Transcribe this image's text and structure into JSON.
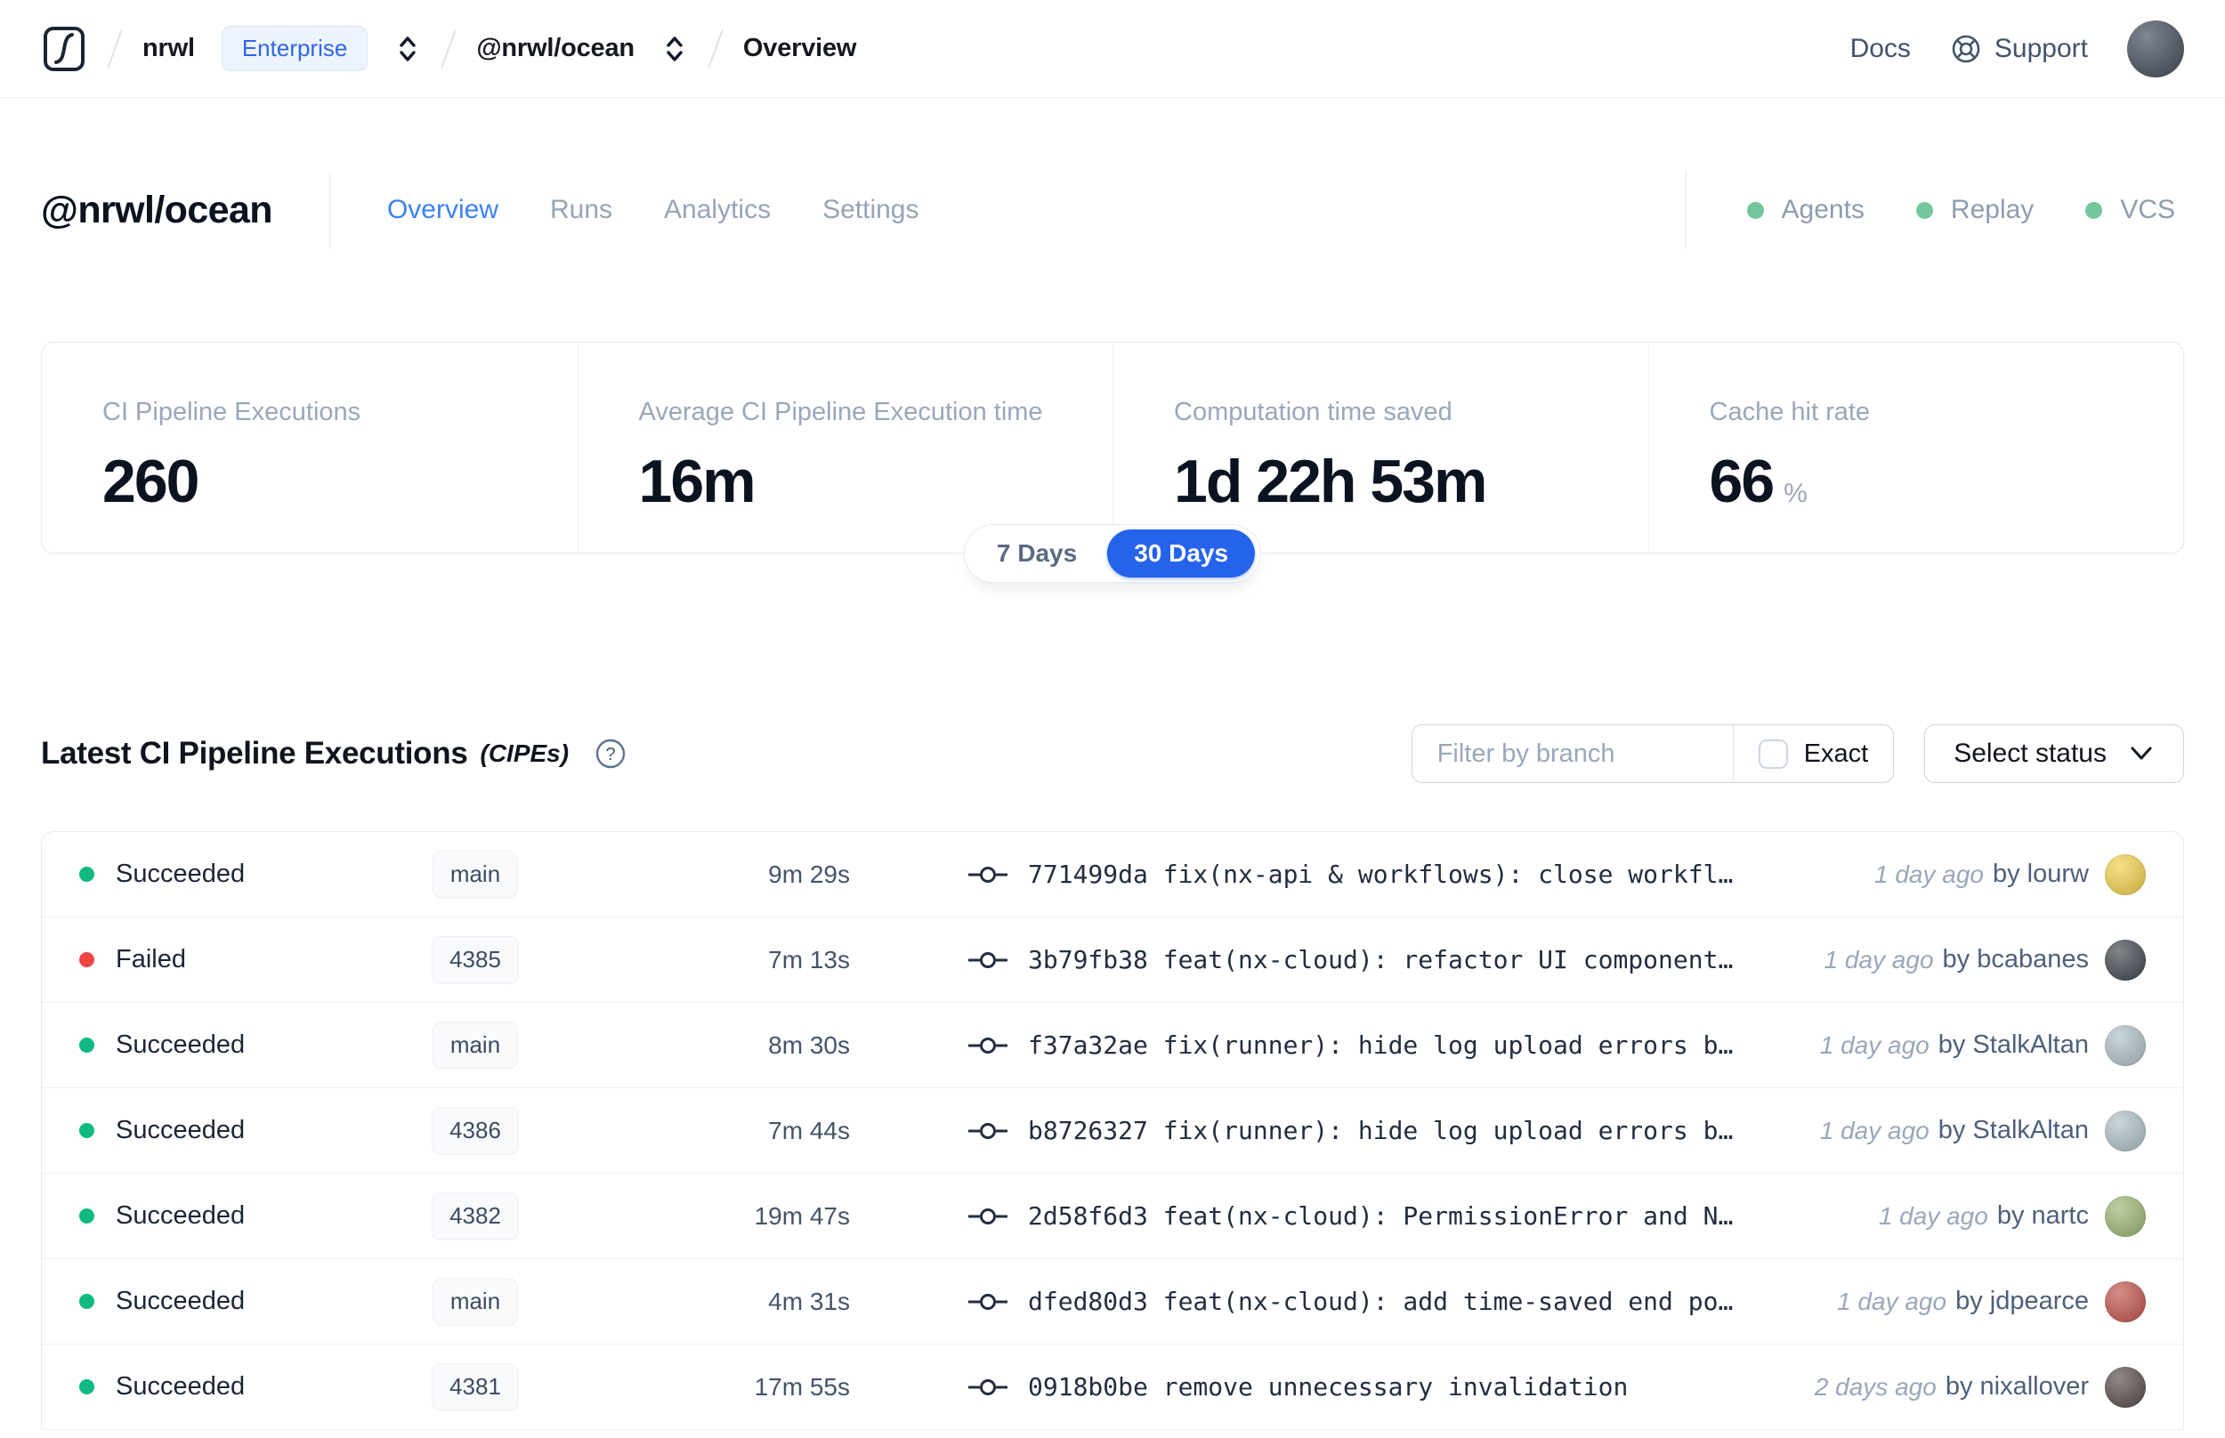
{
  "colors": {
    "accent_tab": "#3b82f6",
    "toggle_active": "#2563eb",
    "success_dot": "#10b981",
    "failed_dot": "#ef4444",
    "integration_dot": "#73c79b",
    "enterprise_badge_text": "#2f66e6"
  },
  "nav": {
    "org": "nrwl",
    "org_badge": "Enterprise",
    "workspace": "@nrwl/ocean",
    "page": "Overview",
    "docs_label": "Docs",
    "support_label": "Support",
    "avatar_color": "#4a5260"
  },
  "header": {
    "title": "@nrwl/ocean",
    "tabs": [
      {
        "label": "Overview",
        "active": true
      },
      {
        "label": "Runs",
        "active": false
      },
      {
        "label": "Analytics",
        "active": false
      },
      {
        "label": "Settings",
        "active": false
      }
    ],
    "integrations": [
      {
        "label": "Agents"
      },
      {
        "label": "Replay"
      },
      {
        "label": "VCS"
      }
    ]
  },
  "stats": {
    "cards": [
      {
        "label": "CI Pipeline Executions",
        "value": "260"
      },
      {
        "label": "Average CI Pipeline Execution time",
        "value": "16m"
      },
      {
        "label": "Computation time saved",
        "value": "1d 22h 53m"
      },
      {
        "label": "Cache hit rate",
        "value": "66",
        "suffix": "%"
      }
    ],
    "range_toggle": {
      "options": [
        "7 Days",
        "30 Days"
      ],
      "selected": "30 Days"
    }
  },
  "cipe_section": {
    "title": "Latest CI Pipeline Executions",
    "title_suffix": "(CIPEs)",
    "filter_placeholder": "Filter by branch",
    "exact_label": "Exact",
    "status_button_label": "Select status",
    "rows": [
      {
        "status": "Succeeded",
        "status_color": "#10b981",
        "branch": "main",
        "duration": "9m 29s",
        "commit": "771499da fix(nx-api & workflows): close workfl…",
        "time_ago": "1 day ago",
        "author": "by lourw",
        "avatar_color": "#f2cf4a"
      },
      {
        "status": "Failed",
        "status_color": "#ef4444",
        "branch": "4385",
        "duration": "7m 13s",
        "commit": "3b79fb38 feat(nx-cloud): refactor UI component…",
        "time_ago": "1 day ago",
        "author": "by bcabanes",
        "avatar_color": "#3d444c"
      },
      {
        "status": "Succeeded",
        "status_color": "#10b981",
        "branch": "main",
        "duration": "8m 30s",
        "commit": "f37a32ae fix(runner): hide log upload errors b…",
        "time_ago": "1 day ago",
        "author": "by StalkAltan",
        "avatar_color": "#aebfc4"
      },
      {
        "status": "Succeeded",
        "status_color": "#10b981",
        "branch": "4386",
        "duration": "7m 44s",
        "commit": "b8726327 fix(runner): hide log upload errors b…",
        "time_ago": "1 day ago",
        "author": "by StalkAltan",
        "avatar_color": "#aebfc4"
      },
      {
        "status": "Succeeded",
        "status_color": "#10b981",
        "branch": "4382",
        "duration": "19m 47s",
        "commit": "2d58f6d3 feat(nx-cloud): PermissionError and N…",
        "time_ago": "1 day ago",
        "author": "by nartc",
        "avatar_color": "#9cb571"
      },
      {
        "status": "Succeeded",
        "status_color": "#10b981",
        "branch": "main",
        "duration": "4m 31s",
        "commit": "dfed80d3 feat(nx-cloud): add time-saved end po…",
        "time_ago": "1 day ago",
        "author": "by jdpearce",
        "avatar_color": "#c05148"
      },
      {
        "status": "Succeeded",
        "status_color": "#10b981",
        "branch": "4381",
        "duration": "17m 55s",
        "commit": "0918b0be remove unnecessary invalidation",
        "time_ago": "2 days ago",
        "author": "by nixallover",
        "avatar_color": "#564a48"
      }
    ]
  }
}
